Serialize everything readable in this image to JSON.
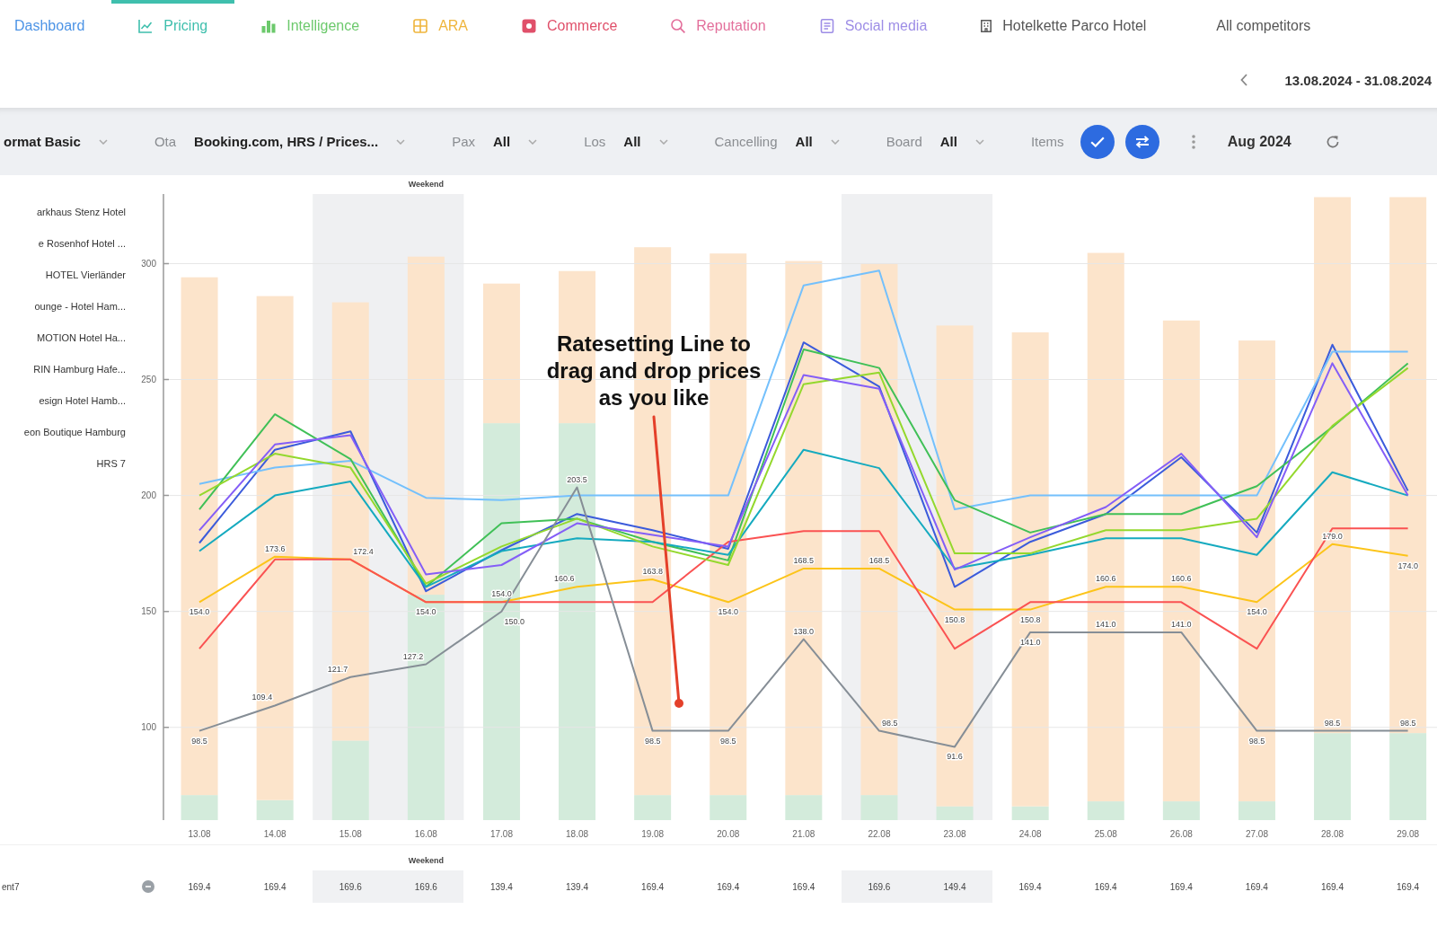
{
  "tabs": [
    {
      "label": "Dashboard",
      "color": "#4d94e6",
      "selected": false
    },
    {
      "label": "Pricing",
      "color": "#3fbfad",
      "selected": true
    },
    {
      "label": "Intelligence",
      "color": "#6cc96c",
      "selected": false
    },
    {
      "label": "ARA",
      "color": "#efb53c",
      "selected": false
    },
    {
      "label": "Commerce",
      "color": "#e0506a",
      "selected": false
    },
    {
      "label": "Reputation",
      "color": "#e36f9b",
      "selected": false
    },
    {
      "label": "Social media",
      "color": "#9d8de6",
      "selected": false
    }
  ],
  "hotel_selector": {
    "label": "Hotelkette Parco Hotel"
  },
  "competitor_selector": {
    "label": "All competitors"
  },
  "date_range": "13.08.2024 - 31.08.2024",
  "filters": [
    {
      "value": "ormat Basic"
    },
    {
      "label": "Ota",
      "value": "Booking.com, HRS / Prices..."
    },
    {
      "label": "Pax",
      "value": "All"
    },
    {
      "label": "Los",
      "value": "All"
    },
    {
      "label": "Cancelling",
      "value": "All"
    },
    {
      "label": "Board",
      "value": "All"
    }
  ],
  "items": {
    "label": "Items"
  },
  "month": "Aug 2024",
  "chart": {
    "band_label": "Weekend",
    "columns": [
      {
        "shaded": false
      },
      {
        "shaded": false
      },
      {
        "shaded": true
      },
      {
        "shaded": true
      },
      {
        "shaded": false
      },
      {
        "shaded": false
      },
      {
        "shaded": false
      },
      {
        "shaded": false
      },
      {
        "shaded": false
      },
      {
        "shaded": true
      },
      {
        "shaded": true
      },
      {
        "shaded": false
      },
      {
        "shaded": false
      },
      {
        "shaded": false
      },
      {
        "shaded": false
      },
      {
        "shaded": false
      },
      {
        "shaded": false
      }
    ],
    "chart_data": {
      "type": "line",
      "categories": [
        "13.08",
        "14.08",
        "15.08",
        "16.08",
        "17.08",
        "18.08",
        "19.08",
        "20.08",
        "21.08",
        "22.08",
        "23.08",
        "24.08",
        "25.08",
        "26.08",
        "27.08",
        "28.08",
        "29.08"
      ],
      "ylim": [
        60,
        330
      ],
      "yticks": [
        100,
        150,
        200,
        250,
        300
      ],
      "grid": true,
      "series": [
        {
          "name": "arkhaus Stenz Hotel",
          "color": "#3b5bdb",
          "values": [
            179.5,
            219.7,
            227.6,
            158.7,
            176.4,
            192,
            185,
            177,
            266,
            247,
            160.6,
            180,
            192,
            216.5,
            184,
            265,
            202
          ]
        },
        {
          "name": "e Rosenhof Hotel ...",
          "color": "#74c0fc",
          "values": [
            205,
            212,
            215,
            199,
            198,
            200,
            200,
            200,
            290.6,
            297,
            194,
            200,
            200,
            200,
            200,
            262,
            262
          ]
        },
        {
          "name": "HOTEL Vierländer",
          "color": "#40c057",
          "values": [
            194,
            235,
            215.7,
            160.6,
            188,
            190,
            180,
            172,
            263,
            255,
            198,
            184,
            192,
            192,
            204,
            229.5,
            257
          ]
        },
        {
          "name": "ounge - Hotel Ham...",
          "color": "#fcc419",
          "values": [
            154,
            173.6,
            172.4,
            154,
            154,
            160.6,
            163.8,
            154,
            168.5,
            168.5,
            150.8,
            150.8,
            160.6,
            160.6,
            154,
            179,
            174
          ],
          "value_labels": [
            "154.0",
            "173.6",
            "172.4",
            "154.0",
            "154.0",
            "160.6",
            "163.8",
            "154.0",
            "168.5",
            "168.5",
            "150.8",
            "150.8",
            "160.6",
            "160.6",
            "154.0",
            "179.0",
            "174.0"
          ]
        },
        {
          "name": "MOTION Hotel Ha...",
          "color": "#fa5252",
          "values": [
            133.9,
            172.4,
            172.4,
            154,
            154,
            154,
            154,
            180,
            184.6,
            184.6,
            133.9,
            154,
            154,
            154,
            133.9,
            185.8,
            185.8
          ]
        },
        {
          "name": "RIN Hamburg Hafe...",
          "color": "#15aabf",
          "values": [
            176,
            200,
            206,
            160.6,
            176,
            181.5,
            180,
            174.4,
            219.7,
            211.8,
            168.5,
            174.4,
            181.5,
            181.5,
            174.4,
            210,
            200
          ]
        },
        {
          "name": "esign Hotel Hamb...",
          "color": "#94d82d",
          "values": [
            200,
            218,
            212,
            162,
            178,
            190,
            178,
            170,
            248,
            253,
            175,
            175,
            185,
            185,
            190,
            230,
            255
          ]
        },
        {
          "name": "eon Boutique Hamburg",
          "color": "#845ef7",
          "values": [
            185,
            222,
            226,
            166,
            170,
            188,
            183,
            178,
            252,
            246,
            168,
            182,
            195,
            218,
            182,
            257,
            200
          ]
        },
        {
          "name": "HRS 7",
          "color": "#868e96",
          "values": [
            98.5,
            109.4,
            121.7,
            127.2,
            150.0,
            203.5,
            98.5,
            98.5,
            138.0,
            98.5,
            91.6,
            141.0,
            141.0,
            141.0,
            98.5,
            98.5,
            98.5
          ],
          "value_labels": [
            "98.5",
            "109.4",
            "121.7",
            "127.2",
            "150.0",
            "203.5",
            "98.5",
            "98.5",
            "138.0",
            "98.5",
            "91.6",
            "141.0",
            "141.0",
            "141.0",
            "98.5",
            "98.5",
            "98.5"
          ]
        }
      ]
    },
    "callout": {
      "text": "Ratesetting Line to drag and drop prices as you like"
    }
  },
  "table": {
    "band_label": "Weekend",
    "rows": [
      {
        "label": "ent7",
        "cells": [
          {
            "text": "169.4",
            "shaded": false
          },
          {
            "text": "169.4",
            "shaded": false
          },
          {
            "text": "169.6",
            "shaded": true
          },
          {
            "text": "169.6",
            "shaded": true
          },
          {
            "text": "139.4",
            "shaded": false
          },
          {
            "text": "139.4",
            "shaded": false
          },
          {
            "text": "169.4",
            "shaded": false
          },
          {
            "text": "169.4",
            "shaded": false
          },
          {
            "text": "169.4",
            "shaded": false
          },
          {
            "text": "169.6",
            "shaded": true
          },
          {
            "text": "149.4",
            "shaded": true
          },
          {
            "text": "169.4",
            "shaded": false
          },
          {
            "text": "169.4",
            "shaded": false
          },
          {
            "text": "169.4",
            "shaded": false
          },
          {
            "text": "169.4",
            "shaded": false
          },
          {
            "text": "169.4",
            "shaded": false
          },
          {
            "text": "169.4",
            "shaded": false
          }
        ]
      }
    ]
  }
}
